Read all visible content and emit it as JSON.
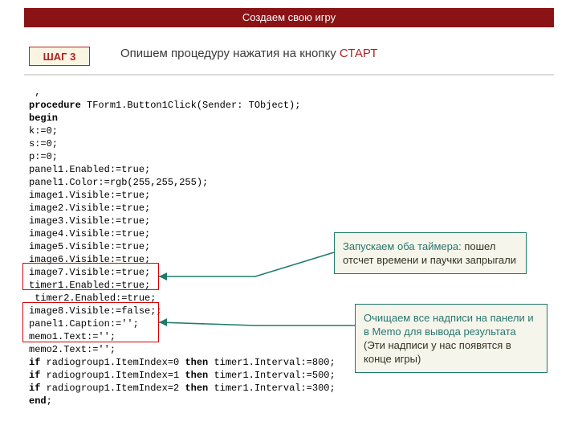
{
  "header": {
    "title": "Создаем свою игру"
  },
  "step": {
    "label": "ШАГ 3"
  },
  "title": {
    "prefix": "Опишем процедуру нажатия на кнопку ",
    "accent": "СТАРТ"
  },
  "code": {
    "l0": " ,",
    "l1a": "procedure",
    "l1b": " TForm1.Button1Click(Sender: TObject);",
    "l2": "begin",
    "l3": "k:=0;",
    "l4": "s:=0;",
    "l5": "p:=0;",
    "l6": "panel1.Enabled:=true;",
    "l7": "panel1.Color:=rgb(255,255,255);",
    "l8": "image1.Visible:=true;",
    "l9": "image2.Visible:=true;",
    "l10": "image3.Visible:=true;",
    "l11": "image4.Visible:=true;",
    "l12": "image5.Visible:=true;",
    "l13": "image6.Visible:=true;",
    "l14": "image7.Visible:=true;",
    "l15": "timer1.Enabled:=true;",
    "l16": " timer2.Enabled:=true;",
    "l17": "image8.Visible:=false;;",
    "l18": "panel1.Caption:='';",
    "l19": "memo1.Text:='';",
    "l20": "memo2.Text:='';",
    "l21a": "if",
    "l21b": " radiogroup1.ItemIndex=0 ",
    "l21c": "then",
    "l21d": " timer1.Interval:=800;",
    "l22a": "if",
    "l22b": " radiogroup1.ItemIndex=1 ",
    "l22c": "then",
    "l22d": " timer1.Interval:=500;",
    "l23a": "if",
    "l23b": " radiogroup1.ItemIndex=2 ",
    "l23c": "then",
    "l23d": " timer1.Interval:=300;",
    "l24": "end",
    "l24b": ";"
  },
  "callout1": {
    "lead": " Запускаем оба таймера: ",
    "rest": "пошел отсчет времени и паучки запрыгали"
  },
  "callout2": {
    "lead": " Очищаем все надписи на панели и в Memo для вывода результата ",
    "rest": "(Эти надписи у нас появятся в конце игры)"
  }
}
